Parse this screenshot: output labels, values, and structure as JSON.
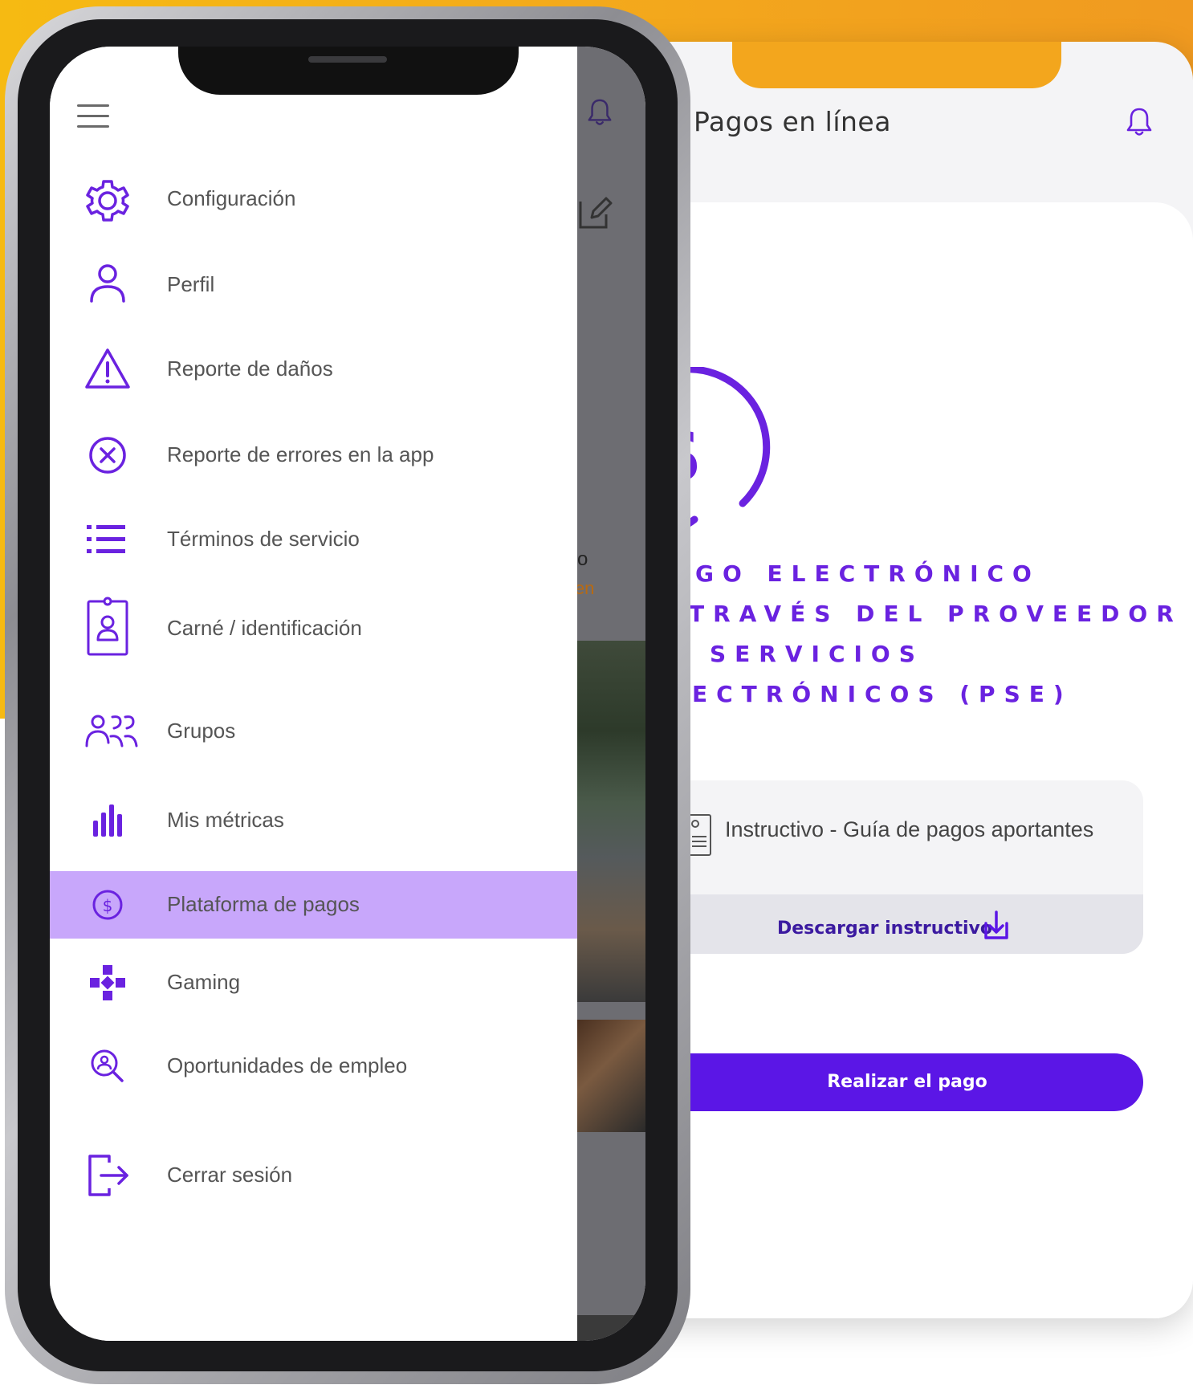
{
  "colors": {
    "accent": "#6a22e0",
    "orange": "#f3a61d",
    "active_bg": "#c8a7fb",
    "button": "#5b16e6"
  },
  "back_screen": {
    "title": "Pagos en línea",
    "pse_lines": [
      "GO ELECTRÓNICO",
      "TRAVÉS DEL PROVEEDOR",
      "SERVICIOS",
      "ECTRÓNICOS (PSE)"
    ],
    "doc_label": "Instructivo - Guía de pagos aportantes",
    "download_label": "Descargar instructivo",
    "pay_button": "Realizar el pago"
  },
  "menu": {
    "items": [
      {
        "label": "Configuración",
        "icon": "gear-icon"
      },
      {
        "label": "Perfil",
        "icon": "user-icon"
      },
      {
        "label": "Reporte de daños",
        "icon": "warning-icon"
      },
      {
        "label": "Reporte de errores en la app",
        "icon": "close-circle-icon"
      },
      {
        "label": "Términos de servicio",
        "icon": "list-icon"
      },
      {
        "label": "Carné / identificación",
        "icon": "id-card-icon"
      },
      {
        "label": "Grupos",
        "icon": "group-icon"
      },
      {
        "label": "Mis métricas",
        "icon": "metrics-icon"
      },
      {
        "label": "Plataforma de pagos",
        "icon": "dollar-circle-icon",
        "active": true
      },
      {
        "label": "Gaming",
        "icon": "gamepad-icon"
      },
      {
        "label": "Oportunidades de empleo",
        "icon": "job-search-icon"
      },
      {
        "label": "Cerrar sesión",
        "icon": "logout-icon"
      }
    ]
  },
  "dim_content": {
    "text1": "o",
    "text2": "ien"
  }
}
